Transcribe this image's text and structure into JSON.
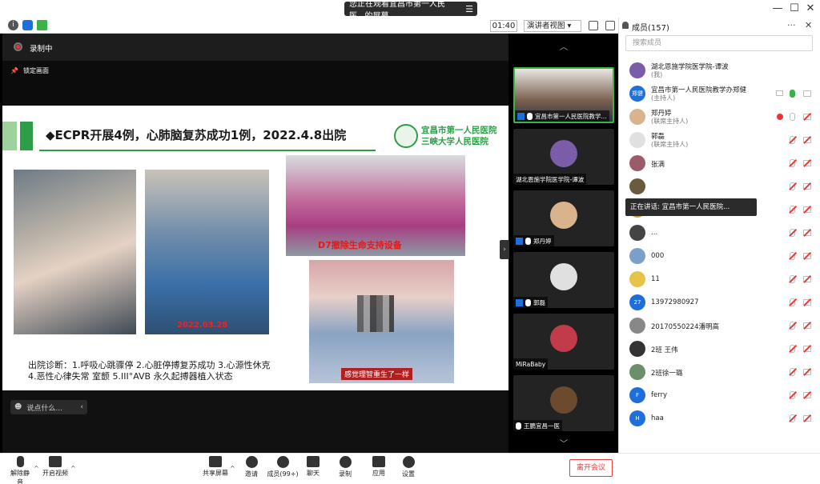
{
  "window": {
    "share_banner": "您正在观看宜昌市第一人民医...的屏幕",
    "minimize": "—",
    "maximize": "☐",
    "close": "✕"
  },
  "subbar": {
    "timer": "01:40",
    "view_label": "演讲者视图 ▾"
  },
  "stage": {
    "recording": "录制中",
    "lock_label": "锁定画面",
    "chat_placeholder": "说点什么..."
  },
  "slide": {
    "headline": "◆ECPR开展4例，心肺脑复苏成功1例，2022.4.8出院",
    "hospital_line1": "宜昌市第一人民医院",
    "hospital_line2": "三峡大学人民医院",
    "photo2_date": "2022.03.28",
    "photo3_caption": "D7撤除生命支持设备",
    "photo4_caption": "感觉理智重生了一样",
    "diagnosis_line1": "出院诊断：1.呼吸心跳骤停  2.心脏停搏复苏成功  3.心源性休克",
    "diagnosis_line2": "4.恶性心律失常 室颤 5.III°AVB 永久起搏器植入状态"
  },
  "gallery": {
    "tiles": [
      {
        "name": "宜昌市第一人民医院教学..."
      },
      {
        "name": "湖北恩施学院医学院-谭波"
      },
      {
        "name": "郑丹婷"
      },
      {
        "name": "郭磊"
      },
      {
        "name": "MiRaBaby"
      },
      {
        "name": "王鹏宜昌一医"
      }
    ]
  },
  "panel": {
    "title": "成员(157)",
    "more": "···",
    "close": "✕",
    "search_placeholder": "搜索成员",
    "participants": [
      {
        "name": "湖北恩施学院医学院-谭波",
        "role": "(我)",
        "color": "#7a5ca8"
      },
      {
        "name": "宜昌市第一人民医院教学办郑健",
        "role": "(主持人)",
        "avatar_text": "郑健",
        "color": "#1e6fd9"
      },
      {
        "name": "郑丹婷",
        "role": "(联席主持人)",
        "color": "#d9b38c"
      },
      {
        "name": "郭磊",
        "role": "(联席主持人)",
        "color": "#e0e0e0"
      },
      {
        "name": "张满",
        "role": "",
        "color": "#9a5b6b"
      },
      {
        "name": "",
        "role": "",
        "color": "#6b5a3e"
      },
      {
        "name": "",
        "role": "",
        "color": "#c9a24a"
      },
      {
        "name": "...",
        "role": "",
        "color": "#444"
      },
      {
        "name": "000",
        "role": "",
        "color": "#7aa0c9"
      },
      {
        "name": "11",
        "role": "",
        "color": "#e8c34a"
      },
      {
        "name": "13972980927",
        "role": "",
        "avatar_text": "27",
        "color": "#1e6fd9"
      },
      {
        "name": "20170550224潘明高",
        "role": "",
        "color": "#888"
      },
      {
        "name": "2班 王伟",
        "role": "",
        "color": "#333"
      },
      {
        "name": "2班徐一璐",
        "role": "",
        "color": "#6a8f6a"
      },
      {
        "name": "ferry",
        "role": "",
        "avatar_text": "F",
        "color": "#1e6fd9"
      },
      {
        "name": "haa",
        "role": "",
        "avatar_text": "H",
        "color": "#1e6fd9"
      }
    ]
  },
  "tooltip": "正在讲话: 宜昌市第一人民医院...",
  "toolbar": {
    "mute": "解除静音",
    "video": "开启视频",
    "share": "共享屏幕",
    "invite": "邀请",
    "members": "成员(99+)",
    "chat": "聊天",
    "record": "录制",
    "apps": "应用",
    "settings": "设置",
    "leave": "离开会议"
  },
  "colors": {
    "accent_green": "#3db247",
    "slide_green": "#2e9d47",
    "leave_red": "#e23c3c",
    "host_blue": "#1e6fd9"
  }
}
